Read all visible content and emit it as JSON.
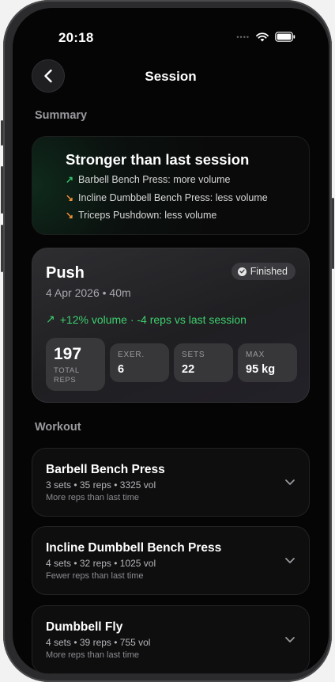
{
  "status": {
    "time": "20:18"
  },
  "header": {
    "title": "Session"
  },
  "summary": {
    "section_label": "Summary",
    "title": "Stronger than last session",
    "lines": [
      {
        "text": "Barbell Bench Press: more volume",
        "trend": "up"
      },
      {
        "text": "Incline Dumbbell Bench Press: less volume",
        "trend": "down"
      },
      {
        "text": "Triceps Pushdown: less volume",
        "trend": "down"
      }
    ]
  },
  "session": {
    "name": "Push",
    "date": "4 Apr 2026 • 40m",
    "badge": "Finished",
    "delta": "+12% volume · -4 reps vs last session",
    "stats": {
      "total_reps": {
        "value": "197",
        "label": "TOTAL REPS"
      },
      "exercises": {
        "label": "EXER.",
        "value": "6"
      },
      "sets": {
        "label": "SETS",
        "value": "22"
      },
      "max": {
        "label": "MAX",
        "value": "95 kg"
      }
    }
  },
  "workout": {
    "section_label": "Workout",
    "exercises": [
      {
        "name": "Barbell Bench Press",
        "meta": "3 sets • 35 reps • 3325 vol",
        "note": "More reps than last time"
      },
      {
        "name": "Incline Dumbbell Bench Press",
        "meta": "4 sets • 32 reps • 1025 vol",
        "note": "Fewer reps than last time"
      },
      {
        "name": "Dumbbell Fly",
        "meta": "4 sets • 39 reps • 755 vol",
        "note": "More reps than last time"
      }
    ]
  },
  "colors": {
    "up": "#34c26a",
    "down": "#f0903a",
    "delta": "#3ccf6c"
  }
}
